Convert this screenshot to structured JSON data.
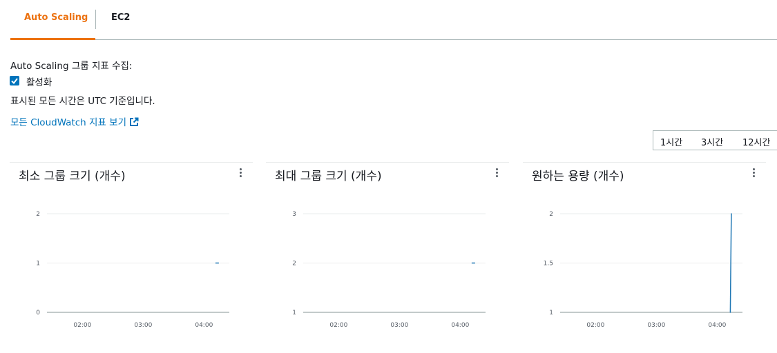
{
  "tabs": [
    {
      "label": "Auto Scaling",
      "active": true
    },
    {
      "label": "EC2",
      "active": false
    }
  ],
  "collection": {
    "label": "Auto Scaling 그룹 지표 수집:",
    "checkbox_label": "활성화",
    "checked": true
  },
  "utc_note": "표시된 모든 시간은 UTC 기준입니다.",
  "cloudwatch_link": "모든 CloudWatch 지표 보기",
  "time_range": {
    "options": [
      "1시간",
      "3시간",
      "12시간"
    ]
  },
  "colors": {
    "accent": "#ec7211",
    "link": "#0073bb",
    "series": "#1f77b4"
  },
  "panels": [
    {
      "title": "최소 그룹 크기 (개수)"
    },
    {
      "title": "최대 그룹 크기 (개수)"
    },
    {
      "title": "원하는 용량 (개수)"
    }
  ],
  "chart_data": [
    {
      "type": "line",
      "title": "최소 그룹 크기 (개수)",
      "xticks": [
        "02:00",
        "03:00",
        "04:00"
      ],
      "yticks": [
        "0",
        "1",
        "2"
      ],
      "ylim": [
        0,
        2
      ],
      "x": [
        "04:13"
      ],
      "values": [
        1
      ]
    },
    {
      "type": "line",
      "title": "최대 그룹 크기 (개수)",
      "xticks": [
        "02:00",
        "03:00",
        "04:00"
      ],
      "yticks": [
        "1",
        "2",
        "3"
      ],
      "ylim": [
        1,
        3
      ],
      "x": [
        "04:13"
      ],
      "values": [
        2
      ]
    },
    {
      "type": "line",
      "title": "원하는 용량 (개수)",
      "xticks": [
        "02:00",
        "03:00",
        "04:00"
      ],
      "yticks": [
        "1",
        "1.5",
        "2"
      ],
      "ylim": [
        1,
        2
      ],
      "x": [
        "04:13",
        "04:14"
      ],
      "values": [
        1,
        2
      ]
    }
  ]
}
